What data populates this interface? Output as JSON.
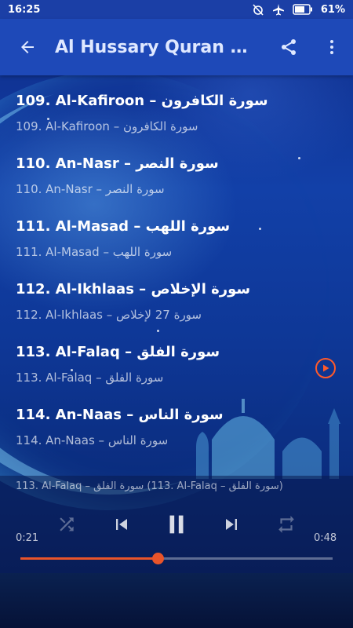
{
  "status_bar": {
    "time": "16:25",
    "battery": "61%"
  },
  "app_bar": {
    "title": "Al Hussary Quran M..."
  },
  "tracks": [
    {
      "title": "109. Al-Kafiroon – سورة الكافرون",
      "subtitle": "109. Al-Kafiroon – سورة الكافرون",
      "playing": false
    },
    {
      "title": "110. An-Nasr – سورة النصر",
      "subtitle": "110. An-Nasr – سورة النصر",
      "playing": false
    },
    {
      "title": "111. Al-Masad – سورة اللهب",
      "subtitle": "111. Al-Masad – سورة اللهب",
      "playing": false
    },
    {
      "title": "112. Al-Ikhlaas – سورة الإخلاص",
      "subtitle": "112. Al-Ikhlaas – سورة 27 لإخلاص",
      "playing": false
    },
    {
      "title": "113. Al-Falaq – سورة الفلق",
      "subtitle": "113. Al-Falaq – سورة الفلق",
      "playing": true
    },
    {
      "title": "114. An-Naas – سورة الناس",
      "subtitle": "114. An-Naas – سورة الناس",
      "playing": false
    }
  ],
  "player": {
    "now_playing": "113. Al-Falaq – سورة الفلق (113. Al-Falaq – سورة الفلق)",
    "elapsed": "0:21",
    "duration": "0:48",
    "progress": 0.44
  },
  "colors": {
    "accent": "#e9542a",
    "appbar": "#1e49b8"
  },
  "icons": [
    "back-arrow-icon",
    "share-icon",
    "more-vert-icon",
    "play-circle-icon",
    "shuffle-icon",
    "skip-previous-icon",
    "pause-icon",
    "skip-next-icon",
    "repeat-icon"
  ]
}
